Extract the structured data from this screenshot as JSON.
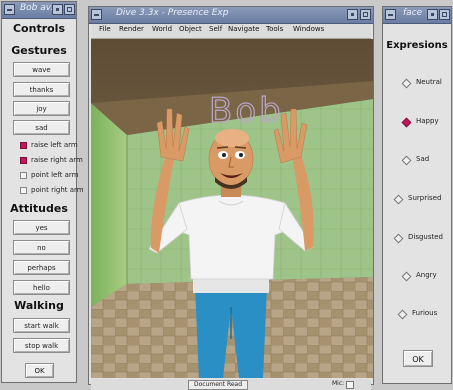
{
  "left_window": {
    "title": "Bob av.",
    "headings": {
      "controls": "Controls",
      "gestures": "Gestures",
      "attitudes": "Attitudes",
      "walking": "Walking"
    },
    "gesture_buttons": [
      "wave",
      "thanks",
      "joy",
      "sad"
    ],
    "arm_toggles": [
      {
        "label": "raise left arm",
        "checked": true
      },
      {
        "label": "raise right arm",
        "checked": true
      },
      {
        "label": "point left arm",
        "checked": false
      },
      {
        "label": "point right arm",
        "checked": false
      }
    ],
    "attitude_buttons": [
      "yes",
      "no",
      "perhaps",
      "hello"
    ],
    "walking_buttons": [
      "start walk",
      "stop walk"
    ],
    "ok_label": "OK"
  },
  "main_window": {
    "title": "Dive 3.3x - Presence Exp",
    "menu": [
      "File",
      "Render",
      "World",
      "Object",
      "Self",
      "Navigate",
      "Tools",
      "Windows"
    ],
    "avatar_name_label": "Bob",
    "status_text": "Document Read",
    "mic_label": "Mic:"
  },
  "right_window": {
    "title": "face",
    "heading": "Expresions",
    "expressions": [
      {
        "label": "Neutral",
        "selected": false
      },
      {
        "label": "Happy",
        "selected": true
      },
      {
        "label": "Sad",
        "selected": false
      },
      {
        "label": "Surprised",
        "selected": false
      },
      {
        "label": "Disgusted",
        "selected": false
      },
      {
        "label": "Angry",
        "selected": false
      },
      {
        "label": "Furious",
        "selected": false
      }
    ],
    "ok_label": "OK"
  },
  "colors": {
    "titlebar": "#6a7ea3",
    "selected_indicator": "#c2185b",
    "shirt": "#f4f4f4",
    "pants": "#2a8fc4"
  }
}
